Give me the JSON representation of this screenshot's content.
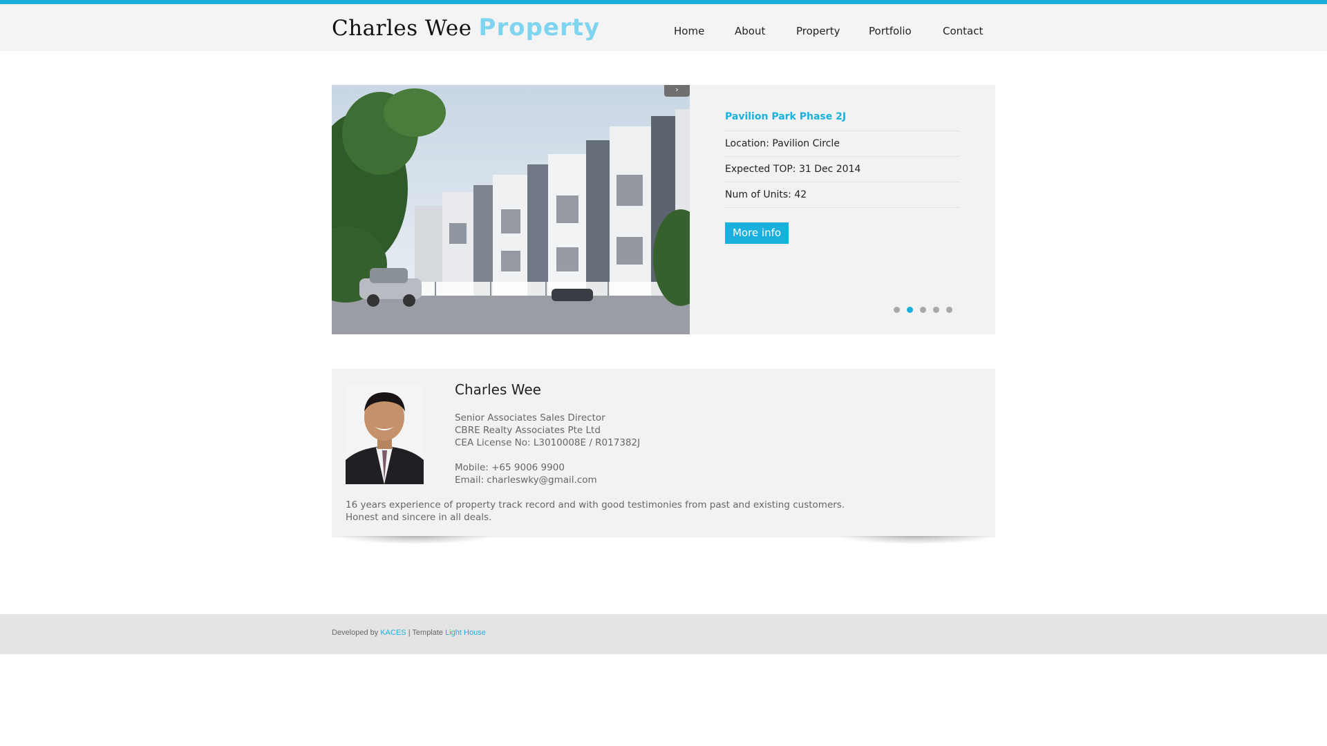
{
  "brand": {
    "name_part1": "Charles Wee",
    "name_part2": "Property",
    "accent_color": "#1ab0de"
  },
  "nav": {
    "items": [
      {
        "label": "Home"
      },
      {
        "label": "About"
      },
      {
        "label": "Property"
      },
      {
        "label": "Portfolio"
      },
      {
        "label": "Contact"
      }
    ]
  },
  "slider": {
    "arrow_icon": "chevron-right-icon",
    "title": "Pavilion Park Phase 2J",
    "location": "Location: Pavilion Circle",
    "expected_top": "Expected TOP: 31 Dec 2014",
    "units": "Num of Units: 42",
    "button_label": "More info",
    "dot_count": 5,
    "active_dot": 2
  },
  "profile": {
    "name": "Charles Wee",
    "title": "Senior Associates Sales Director",
    "company": "CBRE Realty Associates Pte Ltd",
    "license": "CEA License No: L3010008E / R017382J",
    "mobile": "Mobile: +65 9006 9900",
    "email": "Email: charleswky@gmail.com",
    "desc_line1": "16 years experience of property track record and with good testimonies from past and existing customers.",
    "desc_line2": "Honest and sincere in all deals."
  },
  "footer": {
    "developed_by": "Developed by",
    "developer": "KACES",
    "separator": "| Template",
    "template": "Light House"
  }
}
